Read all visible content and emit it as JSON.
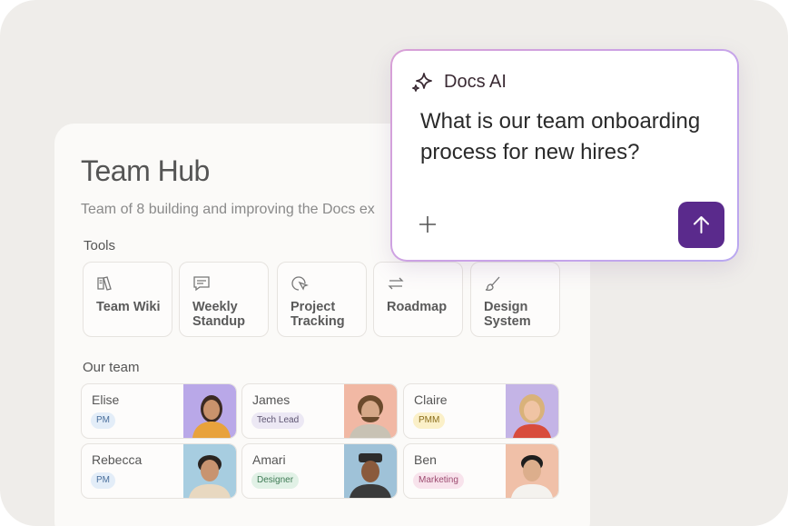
{
  "hub": {
    "title": "Team Hub",
    "subtitle": "Team of 8 building and improving the Docs ex",
    "tools_label": "Tools",
    "team_label": "Our team",
    "tools": [
      {
        "label": "Team Wiki",
        "icon": "book-icon"
      },
      {
        "label": "Weekly Standup",
        "icon": "chat-icon"
      },
      {
        "label": "Project Tracking",
        "icon": "cursor-click-icon"
      },
      {
        "label": "Roadmap",
        "icon": "arrows-exchange-icon"
      },
      {
        "label": "Design System",
        "icon": "brush-icon"
      }
    ],
    "members": [
      {
        "name": "Elise",
        "role": "PM",
        "badge_bg": "#e3edf8",
        "badge_fg": "#4a6f9c",
        "photo_bg": "#b9a8e8"
      },
      {
        "name": "James",
        "role": "Tech Lead",
        "badge_bg": "#ece8f4",
        "badge_fg": "#5c5470",
        "photo_bg": "#f1b8a4"
      },
      {
        "name": "Claire",
        "role": "PMM",
        "badge_bg": "#fbf0c8",
        "badge_fg": "#8a6d1c",
        "photo_bg": "#c4b4e6"
      },
      {
        "name": "Rebecca",
        "role": "PM",
        "badge_bg": "#e3edf8",
        "badge_fg": "#4a6f9c",
        "photo_bg": "#a7cde0"
      },
      {
        "name": "Amari",
        "role": "Designer",
        "badge_bg": "#e1f1e6",
        "badge_fg": "#3e7a54",
        "photo_bg": "#9fc2d8"
      },
      {
        "name": "Ben",
        "role": "Marketing",
        "badge_bg": "#f8e3ec",
        "badge_fg": "#9c4a6f",
        "photo_bg": "#f0c0a8"
      }
    ]
  },
  "ai": {
    "title": "Docs AI",
    "question": "What is our team onboarding process for new hires?",
    "send_icon": "arrow-up-icon",
    "attach_icon": "plus-icon",
    "accent": "#5a2a8c"
  }
}
